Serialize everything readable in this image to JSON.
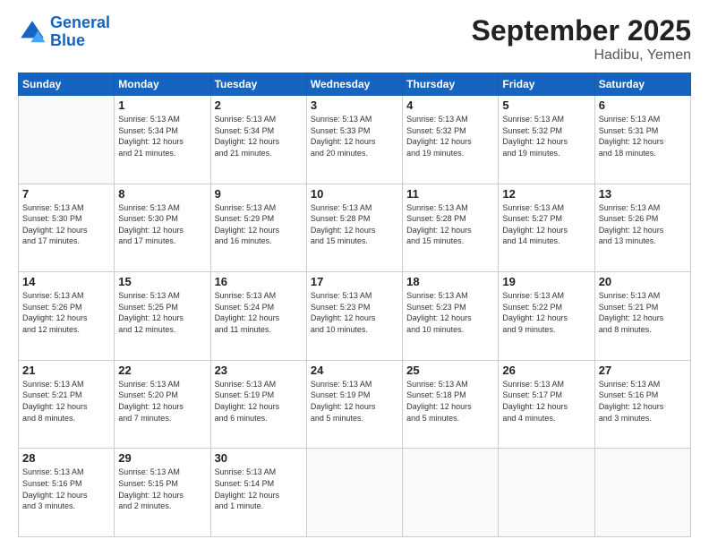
{
  "logo": {
    "line1": "General",
    "line2": "Blue"
  },
  "title": "September 2025",
  "location": "Hadibu, Yemen",
  "days_of_week": [
    "Sunday",
    "Monday",
    "Tuesday",
    "Wednesday",
    "Thursday",
    "Friday",
    "Saturday"
  ],
  "weeks": [
    [
      {
        "num": "",
        "info": ""
      },
      {
        "num": "1",
        "info": "Sunrise: 5:13 AM\nSunset: 5:34 PM\nDaylight: 12 hours\nand 21 minutes."
      },
      {
        "num": "2",
        "info": "Sunrise: 5:13 AM\nSunset: 5:34 PM\nDaylight: 12 hours\nand 21 minutes."
      },
      {
        "num": "3",
        "info": "Sunrise: 5:13 AM\nSunset: 5:33 PM\nDaylight: 12 hours\nand 20 minutes."
      },
      {
        "num": "4",
        "info": "Sunrise: 5:13 AM\nSunset: 5:32 PM\nDaylight: 12 hours\nand 19 minutes."
      },
      {
        "num": "5",
        "info": "Sunrise: 5:13 AM\nSunset: 5:32 PM\nDaylight: 12 hours\nand 19 minutes."
      },
      {
        "num": "6",
        "info": "Sunrise: 5:13 AM\nSunset: 5:31 PM\nDaylight: 12 hours\nand 18 minutes."
      }
    ],
    [
      {
        "num": "7",
        "info": "Sunrise: 5:13 AM\nSunset: 5:30 PM\nDaylight: 12 hours\nand 17 minutes."
      },
      {
        "num": "8",
        "info": "Sunrise: 5:13 AM\nSunset: 5:30 PM\nDaylight: 12 hours\nand 17 minutes."
      },
      {
        "num": "9",
        "info": "Sunrise: 5:13 AM\nSunset: 5:29 PM\nDaylight: 12 hours\nand 16 minutes."
      },
      {
        "num": "10",
        "info": "Sunrise: 5:13 AM\nSunset: 5:28 PM\nDaylight: 12 hours\nand 15 minutes."
      },
      {
        "num": "11",
        "info": "Sunrise: 5:13 AM\nSunset: 5:28 PM\nDaylight: 12 hours\nand 15 minutes."
      },
      {
        "num": "12",
        "info": "Sunrise: 5:13 AM\nSunset: 5:27 PM\nDaylight: 12 hours\nand 14 minutes."
      },
      {
        "num": "13",
        "info": "Sunrise: 5:13 AM\nSunset: 5:26 PM\nDaylight: 12 hours\nand 13 minutes."
      }
    ],
    [
      {
        "num": "14",
        "info": "Sunrise: 5:13 AM\nSunset: 5:26 PM\nDaylight: 12 hours\nand 12 minutes."
      },
      {
        "num": "15",
        "info": "Sunrise: 5:13 AM\nSunset: 5:25 PM\nDaylight: 12 hours\nand 12 minutes."
      },
      {
        "num": "16",
        "info": "Sunrise: 5:13 AM\nSunset: 5:24 PM\nDaylight: 12 hours\nand 11 minutes."
      },
      {
        "num": "17",
        "info": "Sunrise: 5:13 AM\nSunset: 5:23 PM\nDaylight: 12 hours\nand 10 minutes."
      },
      {
        "num": "18",
        "info": "Sunrise: 5:13 AM\nSunset: 5:23 PM\nDaylight: 12 hours\nand 10 minutes."
      },
      {
        "num": "19",
        "info": "Sunrise: 5:13 AM\nSunset: 5:22 PM\nDaylight: 12 hours\nand 9 minutes."
      },
      {
        "num": "20",
        "info": "Sunrise: 5:13 AM\nSunset: 5:21 PM\nDaylight: 12 hours\nand 8 minutes."
      }
    ],
    [
      {
        "num": "21",
        "info": "Sunrise: 5:13 AM\nSunset: 5:21 PM\nDaylight: 12 hours\nand 8 minutes."
      },
      {
        "num": "22",
        "info": "Sunrise: 5:13 AM\nSunset: 5:20 PM\nDaylight: 12 hours\nand 7 minutes."
      },
      {
        "num": "23",
        "info": "Sunrise: 5:13 AM\nSunset: 5:19 PM\nDaylight: 12 hours\nand 6 minutes."
      },
      {
        "num": "24",
        "info": "Sunrise: 5:13 AM\nSunset: 5:19 PM\nDaylight: 12 hours\nand 5 minutes."
      },
      {
        "num": "25",
        "info": "Sunrise: 5:13 AM\nSunset: 5:18 PM\nDaylight: 12 hours\nand 5 minutes."
      },
      {
        "num": "26",
        "info": "Sunrise: 5:13 AM\nSunset: 5:17 PM\nDaylight: 12 hours\nand 4 minutes."
      },
      {
        "num": "27",
        "info": "Sunrise: 5:13 AM\nSunset: 5:16 PM\nDaylight: 12 hours\nand 3 minutes."
      }
    ],
    [
      {
        "num": "28",
        "info": "Sunrise: 5:13 AM\nSunset: 5:16 PM\nDaylight: 12 hours\nand 3 minutes."
      },
      {
        "num": "29",
        "info": "Sunrise: 5:13 AM\nSunset: 5:15 PM\nDaylight: 12 hours\nand 2 minutes."
      },
      {
        "num": "30",
        "info": "Sunrise: 5:13 AM\nSunset: 5:14 PM\nDaylight: 12 hours\nand 1 minute."
      },
      {
        "num": "",
        "info": ""
      },
      {
        "num": "",
        "info": ""
      },
      {
        "num": "",
        "info": ""
      },
      {
        "num": "",
        "info": ""
      }
    ]
  ]
}
